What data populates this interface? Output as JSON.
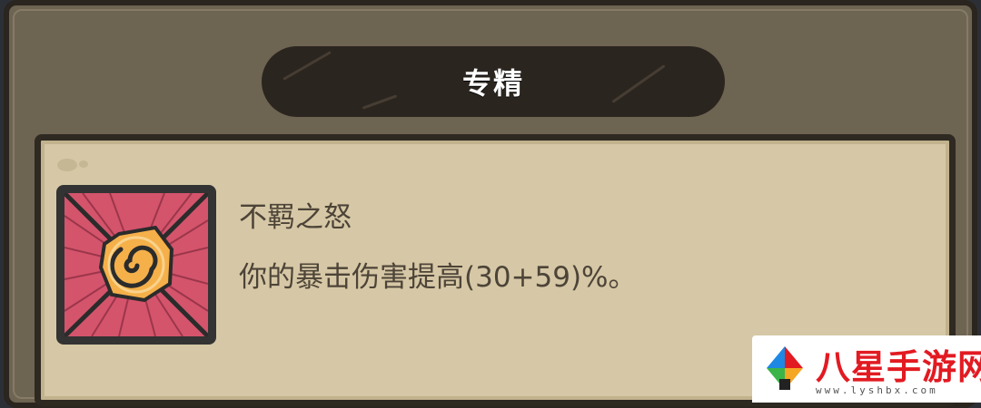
{
  "panel": {
    "title": "专精"
  },
  "skill": {
    "name": "不羁之怒",
    "description": "你的暴击伤害提高(30+59)%。",
    "icon": "spiral-rage-icon"
  },
  "watermark": {
    "title": "八星手游网",
    "url": "www.lyshbx.com",
    "logo": "colorful-pinwheel-logo"
  },
  "colors": {
    "frame": "#6e6452",
    "parchment": "#d6c8a6",
    "title_pill": "#2b251f",
    "text": "#4d4438",
    "icon_bg": "#d4546c",
    "icon_center": "#f5b04a",
    "watermark_red": "#e21a22"
  }
}
